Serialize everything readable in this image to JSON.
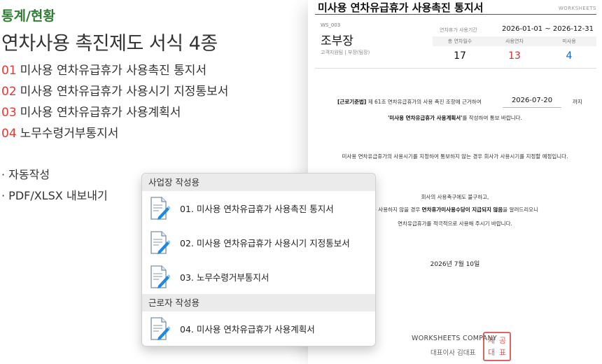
{
  "promo": {
    "category": "통계/현황",
    "headline": "연차사용 촉진제도 서식 4종",
    "forms": [
      {
        "num": "01",
        "label": "미사용 연차유급휴가 사용촉진 통지서"
      },
      {
        "num": "02",
        "label": "미사용 연차유급휴가 사용시기 지정통보서"
      },
      {
        "num": "03",
        "label": "미사용 연차유급휴가 사용계획서"
      },
      {
        "num": "04",
        "label": "노무수령거부통지서"
      }
    ],
    "bullets": [
      "· 자동작성",
      "· PDF/XLSX 내보내기"
    ]
  },
  "doc": {
    "title": "미사용 연차유급휴가 사용촉진 통지서",
    "tag": "WORKSHEETS",
    "ws_id": "WS_003",
    "person": "조부장",
    "dept": "고객지원팀 | 부장(팀장)",
    "period_label": "연차휴가 사용기간",
    "period_value": "2026-01-01 ~ 2026-12-31",
    "stats": [
      {
        "label": "총 연차일수",
        "value": "17"
      },
      {
        "label": "사용연차",
        "value": "13"
      },
      {
        "label": "미사용",
        "value": "4"
      }
    ],
    "legal_bold": "[근로기준법]",
    "legal_text": "제 61조 연차유급휴가의 사용 촉진 조항에 근거하여",
    "deadline_date": "2026-07-20",
    "deadline_suffix": "까지",
    "plan_bold": "'미사용 연차유급휴가 사용계획서'",
    "plan_text": "를 작성하여 통보 바랍니다.",
    "notice_text": "미사용 연차유급휴가의 사용시기를 지정하여 통보하지 않는 경우 회사가 사용시기를 지정할 예정입니다.",
    "request_text": "회사의 사용촉구에도 불구하고,",
    "warn_pre": "를 사용하지 않을 경우",
    "warn_bold": "연차휴가미사용수당이 지급되지 않음",
    "warn_post": "을 알려드리오니",
    "encourage_text": "연차유급휴가를 적극적으로 사용해 주시기 바랍니다.",
    "sign_date": "2026년 7월 10일",
    "company": "WORKSHEETS COMPANY",
    "ceo": "대표이사 김대표",
    "seal_chars": [
      "재",
      "공",
      "대",
      "표"
    ]
  },
  "menu": {
    "sections": [
      {
        "title": "사업장 작성용",
        "items": [
          {
            "label": "01. 미사용 연차유급휴가 사용촉진 통지서"
          },
          {
            "label": "02. 미사용 연차유급휴가 사용시기 지정통보서"
          },
          {
            "label": "03. 노무수령거부통지서"
          }
        ]
      },
      {
        "title": "근로자 작성용",
        "items": [
          {
            "label": "04. 미사용 연차유급휴가 사용계획서"
          }
        ]
      }
    ]
  },
  "colors": {
    "accent_green": "#2e7d32",
    "number_red": "#e53935",
    "stat_red": "#d32f2f",
    "stat_blue": "#1565c0",
    "icon_blue": "#1e88e5"
  }
}
